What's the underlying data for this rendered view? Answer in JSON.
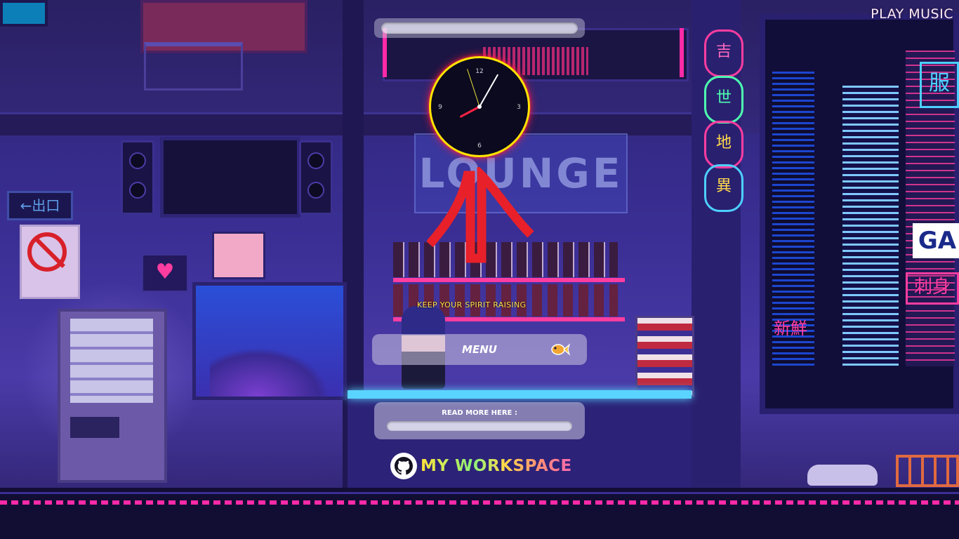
{
  "header": {
    "play_music_label": "PLAY MUSIC"
  },
  "clock": {
    "numerals": [
      "12",
      "3",
      "6",
      "9"
    ],
    "hour": 8,
    "minute": 4,
    "second": 57
  },
  "tagline": "KEEP YOUR SPIRIT RAISING",
  "menu": {
    "label": "MENU",
    "icon": "goldfish-icon"
  },
  "read_more": {
    "label": "READ MORE HERE :"
  },
  "workspace": {
    "label": "MY WORKSPACE",
    "icon": "github-icon"
  },
  "scene": {
    "sign_text": "LOUNGE",
    "exit_sign": "←出口",
    "city_sign": "GA",
    "lanterns": [
      "吉",
      "世",
      "地",
      "異"
    ],
    "colors": {
      "accent_pink": "#ff2aa8",
      "accent_cyan": "#5ad4ff",
      "clock_ring": "#ffe400",
      "logo_red": "#e8202a",
      "tagline_yellow": "#ffe14a"
    }
  }
}
